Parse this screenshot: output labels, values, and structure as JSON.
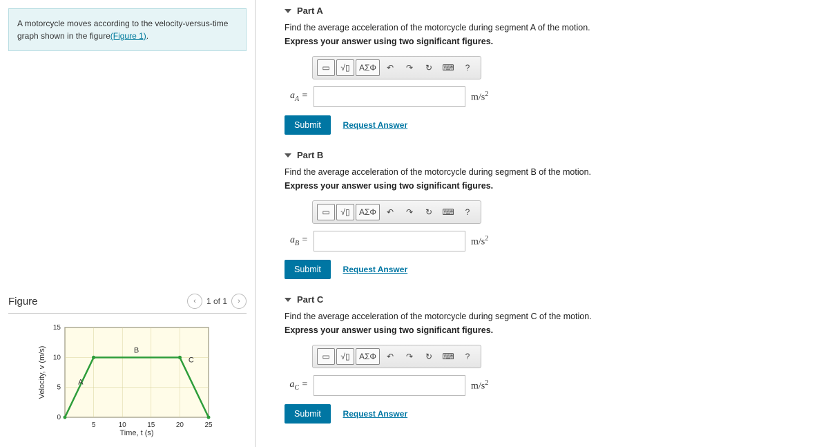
{
  "problem": {
    "text_before": "A motorcycle moves according to the velocity-versus-time graph shown in the figure",
    "link": "(Figure 1)",
    "text_after": "."
  },
  "figure": {
    "title": "Figure",
    "nav_count": "1 of 1",
    "xlabel": "Time, t (s)",
    "ylabel": "Velocity, v (m/s)"
  },
  "parts": [
    {
      "header": "Part A",
      "prompt": "Find the average acceleration of the motorcycle during segment A of the motion.",
      "instruct": "Express your answer using two significant figures.",
      "var": "a",
      "sub": "A",
      "unit_base": "m/s",
      "unit_sup": "2",
      "submit": "Submit",
      "request": "Request Answer"
    },
    {
      "header": "Part B",
      "prompt": "Find the average acceleration of the motorcycle during segment B of the motion.",
      "instruct": "Express your answer using two significant figures.",
      "var": "a",
      "sub": "B",
      "unit_base": "m/s",
      "unit_sup": "2",
      "submit": "Submit",
      "request": "Request Answer"
    },
    {
      "header": "Part C",
      "prompt": "Find the average acceleration of the motorcycle during segment C of the motion.",
      "instruct": "Express your answer using two significant figures.",
      "var": "a",
      "sub": "C",
      "unit_base": "m/s",
      "unit_sup": "2",
      "submit": "Submit",
      "request": "Request Answer"
    }
  ],
  "toolbar": {
    "template": "▭",
    "sqrt": "√▯",
    "greek": "ΑΣΦ",
    "undo": "↶",
    "redo": "↷",
    "reset": "↻",
    "keyboard": "⌨",
    "help": "?"
  },
  "chart_data": {
    "type": "line",
    "title": "",
    "xlabel": "Time, t (s)",
    "ylabel": "Velocity, v (m/s)",
    "xlim": [
      0,
      25
    ],
    "ylim": [
      0,
      15
    ],
    "xticks": [
      0,
      5,
      10,
      15,
      20,
      25
    ],
    "yticks": [
      0,
      5,
      10,
      15
    ],
    "series": [
      {
        "name": "A",
        "points": [
          [
            0,
            0
          ],
          [
            5,
            10
          ]
        ],
        "label_pos": [
          2.3,
          5.5
        ]
      },
      {
        "name": "B",
        "points": [
          [
            5,
            10
          ],
          [
            20,
            10
          ]
        ],
        "label_pos": [
          12,
          10.8
        ]
      },
      {
        "name": "C",
        "points": [
          [
            20,
            10
          ],
          [
            25,
            0
          ]
        ],
        "label_pos": [
          21.5,
          9.2
        ]
      }
    ]
  }
}
